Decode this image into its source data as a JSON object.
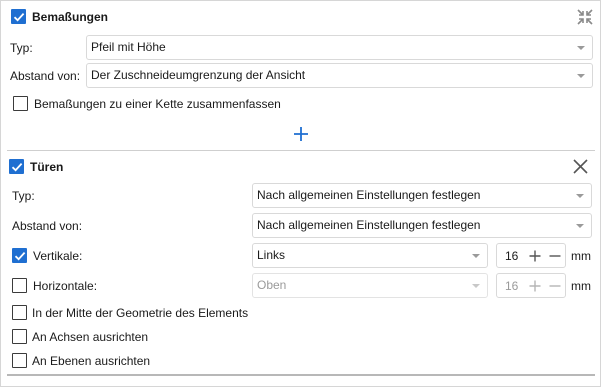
{
  "section1": {
    "title": "Bemaßungen",
    "checked": true,
    "collapse_icon": "collapse-arrows-icon",
    "rows": [
      {
        "label": "Typ:",
        "value": "Pfeil mit Höhe"
      },
      {
        "label": "Abstand von:",
        "value": "Der Zuschneideumgrenzung der Ansicht"
      }
    ],
    "chain_label": "Bemaßungen zu einer Kette zusammenfassen",
    "chain_checked": false,
    "add_icon": "plus-icon"
  },
  "section2": {
    "title": "Türen",
    "checked": true,
    "close_icon": "close-icon",
    "type_label": "Typ:",
    "type_value": "Nach allgemeinen Einstellungen festlegen",
    "distance_label": "Abstand von:",
    "distance_value": "Nach allgemeinen Einstellungen festlegen",
    "vertical": {
      "label": "Vertikale:",
      "checked": true,
      "value": "Links",
      "number": "16",
      "unit": "mm"
    },
    "horizontal": {
      "label": "Horizontale:",
      "checked": false,
      "value": "Oben",
      "number": "16",
      "unit": "mm"
    },
    "options": [
      {
        "label": "In der Mitte der Geometrie des Elements",
        "checked": false
      },
      {
        "label": "An Achsen ausrichten",
        "checked": false
      },
      {
        "label": "An Ebenen ausrichten",
        "checked": false
      }
    ]
  },
  "colors": {
    "accent": "#1f6fd1",
    "border": "#d9d9d9",
    "disabled_text": "#9a9a9a"
  }
}
